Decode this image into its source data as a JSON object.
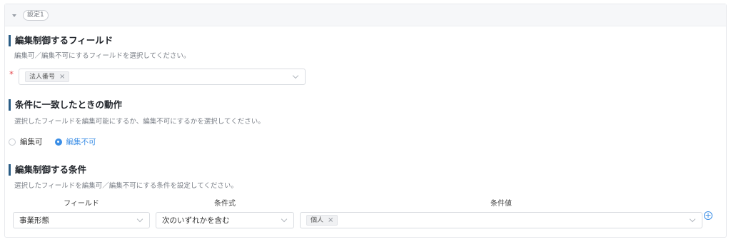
{
  "panel": {
    "header_label": "設定1"
  },
  "field_section": {
    "title": "編集制御するフィールド",
    "description": "編集可／編集不可にするフィールドを選択してください。",
    "required_mark": "*",
    "selected_tag": "法人番号",
    "tag_remove": "×"
  },
  "action_section": {
    "title": "条件に一致したときの動作",
    "description": "選択したフィールドを編集可能にするか、編集不可にするかを選択してください。",
    "options": [
      {
        "label": "編集可",
        "selected": false
      },
      {
        "label": "編集不可",
        "selected": true
      }
    ]
  },
  "condition_section": {
    "title": "編集制御する条件",
    "description": "選択したフィールドを編集可／編集不可にする条件を設定してください。",
    "columns": [
      "フィールド",
      "条件式",
      "条件値"
    ],
    "row": {
      "field": "事業形態",
      "operator": "次のいずれかを含む",
      "value_tag": "個人",
      "tag_remove": "×"
    },
    "add_label": "+"
  },
  "colors": {
    "accent": "#3b8ee6",
    "title_bar": "#2a5d86",
    "required": "#e5484d"
  }
}
